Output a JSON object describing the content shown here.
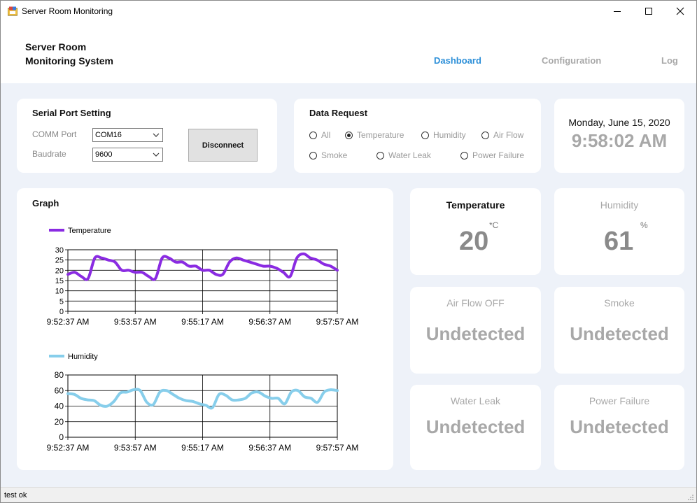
{
  "window": {
    "title": "Server Room Monitoring"
  },
  "header": {
    "brand_line1": "Server Room",
    "brand_line2": "Monitoring System",
    "nav": {
      "dashboard": "Dashboard",
      "configuration": "Configuration",
      "log": "Log"
    }
  },
  "serial": {
    "title": "Serial Port Setting",
    "comm_label": "COMM Port",
    "comm_value": "COM16",
    "baud_label": "Baudrate",
    "baud_value": "9600",
    "button": "Disconnect"
  },
  "request": {
    "title": "Data Request",
    "options": [
      "All",
      "Temperature",
      "Humidity",
      "Air Flow",
      "Smoke",
      "Water Leak",
      "Power Failure"
    ],
    "selected": "Temperature"
  },
  "clock": {
    "date": "Monday, June 15, 2020",
    "time": "9:58:02 AM"
  },
  "graph": {
    "title": "Graph"
  },
  "chart_data": [
    {
      "type": "line",
      "series": [
        {
          "name": "Temperature",
          "color": "#8a2be2",
          "values": [
            18,
            19,
            17,
            16,
            26,
            26,
            25,
            24,
            20,
            20,
            19,
            19,
            17,
            16,
            26,
            26,
            24,
            24,
            22,
            22,
            20,
            20,
            18,
            18,
            24,
            26,
            25,
            24,
            23,
            22,
            22,
            21,
            19,
            17,
            26,
            28,
            26,
            25,
            23,
            22,
            20
          ]
        }
      ],
      "x_ticks": [
        "9:52:37 AM",
        "9:53:57 AM",
        "9:55:17 AM",
        "9:56:37 AM",
        "9:57:57 AM"
      ],
      "y_ticks": [
        0,
        5,
        10,
        15,
        20,
        25,
        30
      ],
      "ylim": [
        0,
        30
      ],
      "grid": true,
      "legend": "top-left"
    },
    {
      "type": "line",
      "series": [
        {
          "name": "Humidity",
          "color": "#87ceeb",
          "values": [
            56,
            55,
            50,
            48,
            47,
            41,
            40,
            46,
            57,
            58,
            61,
            60,
            45,
            42,
            58,
            60,
            55,
            50,
            47,
            46,
            43,
            41,
            38,
            55,
            54,
            48,
            48,
            50,
            57,
            58,
            53,
            50,
            50,
            43,
            58,
            60,
            52,
            50,
            45,
            58,
            61,
            60
          ]
        }
      ],
      "x_ticks": [
        "9:52:37 AM",
        "9:53:57 AM",
        "9:55:17 AM",
        "9:56:37 AM",
        "9:57:57 AM"
      ],
      "y_ticks": [
        0,
        20,
        40,
        60,
        80
      ],
      "ylim": [
        0,
        80
      ],
      "grid": true,
      "legend": "top-left"
    }
  ],
  "tiles": {
    "temperature": {
      "title": "Temperature",
      "value": "20",
      "unit": "*C"
    },
    "humidity": {
      "title": "Humidity",
      "value": "61",
      "unit": "%"
    },
    "airflow": {
      "title": "Air Flow OFF",
      "value": "Undetected"
    },
    "smoke": {
      "title": "Smoke",
      "value": "Undetected"
    },
    "waterleak": {
      "title": "Water Leak",
      "value": "Undetected"
    },
    "power": {
      "title": "Power Failure",
      "value": "Undetected"
    }
  },
  "status": {
    "text": "test ok"
  }
}
